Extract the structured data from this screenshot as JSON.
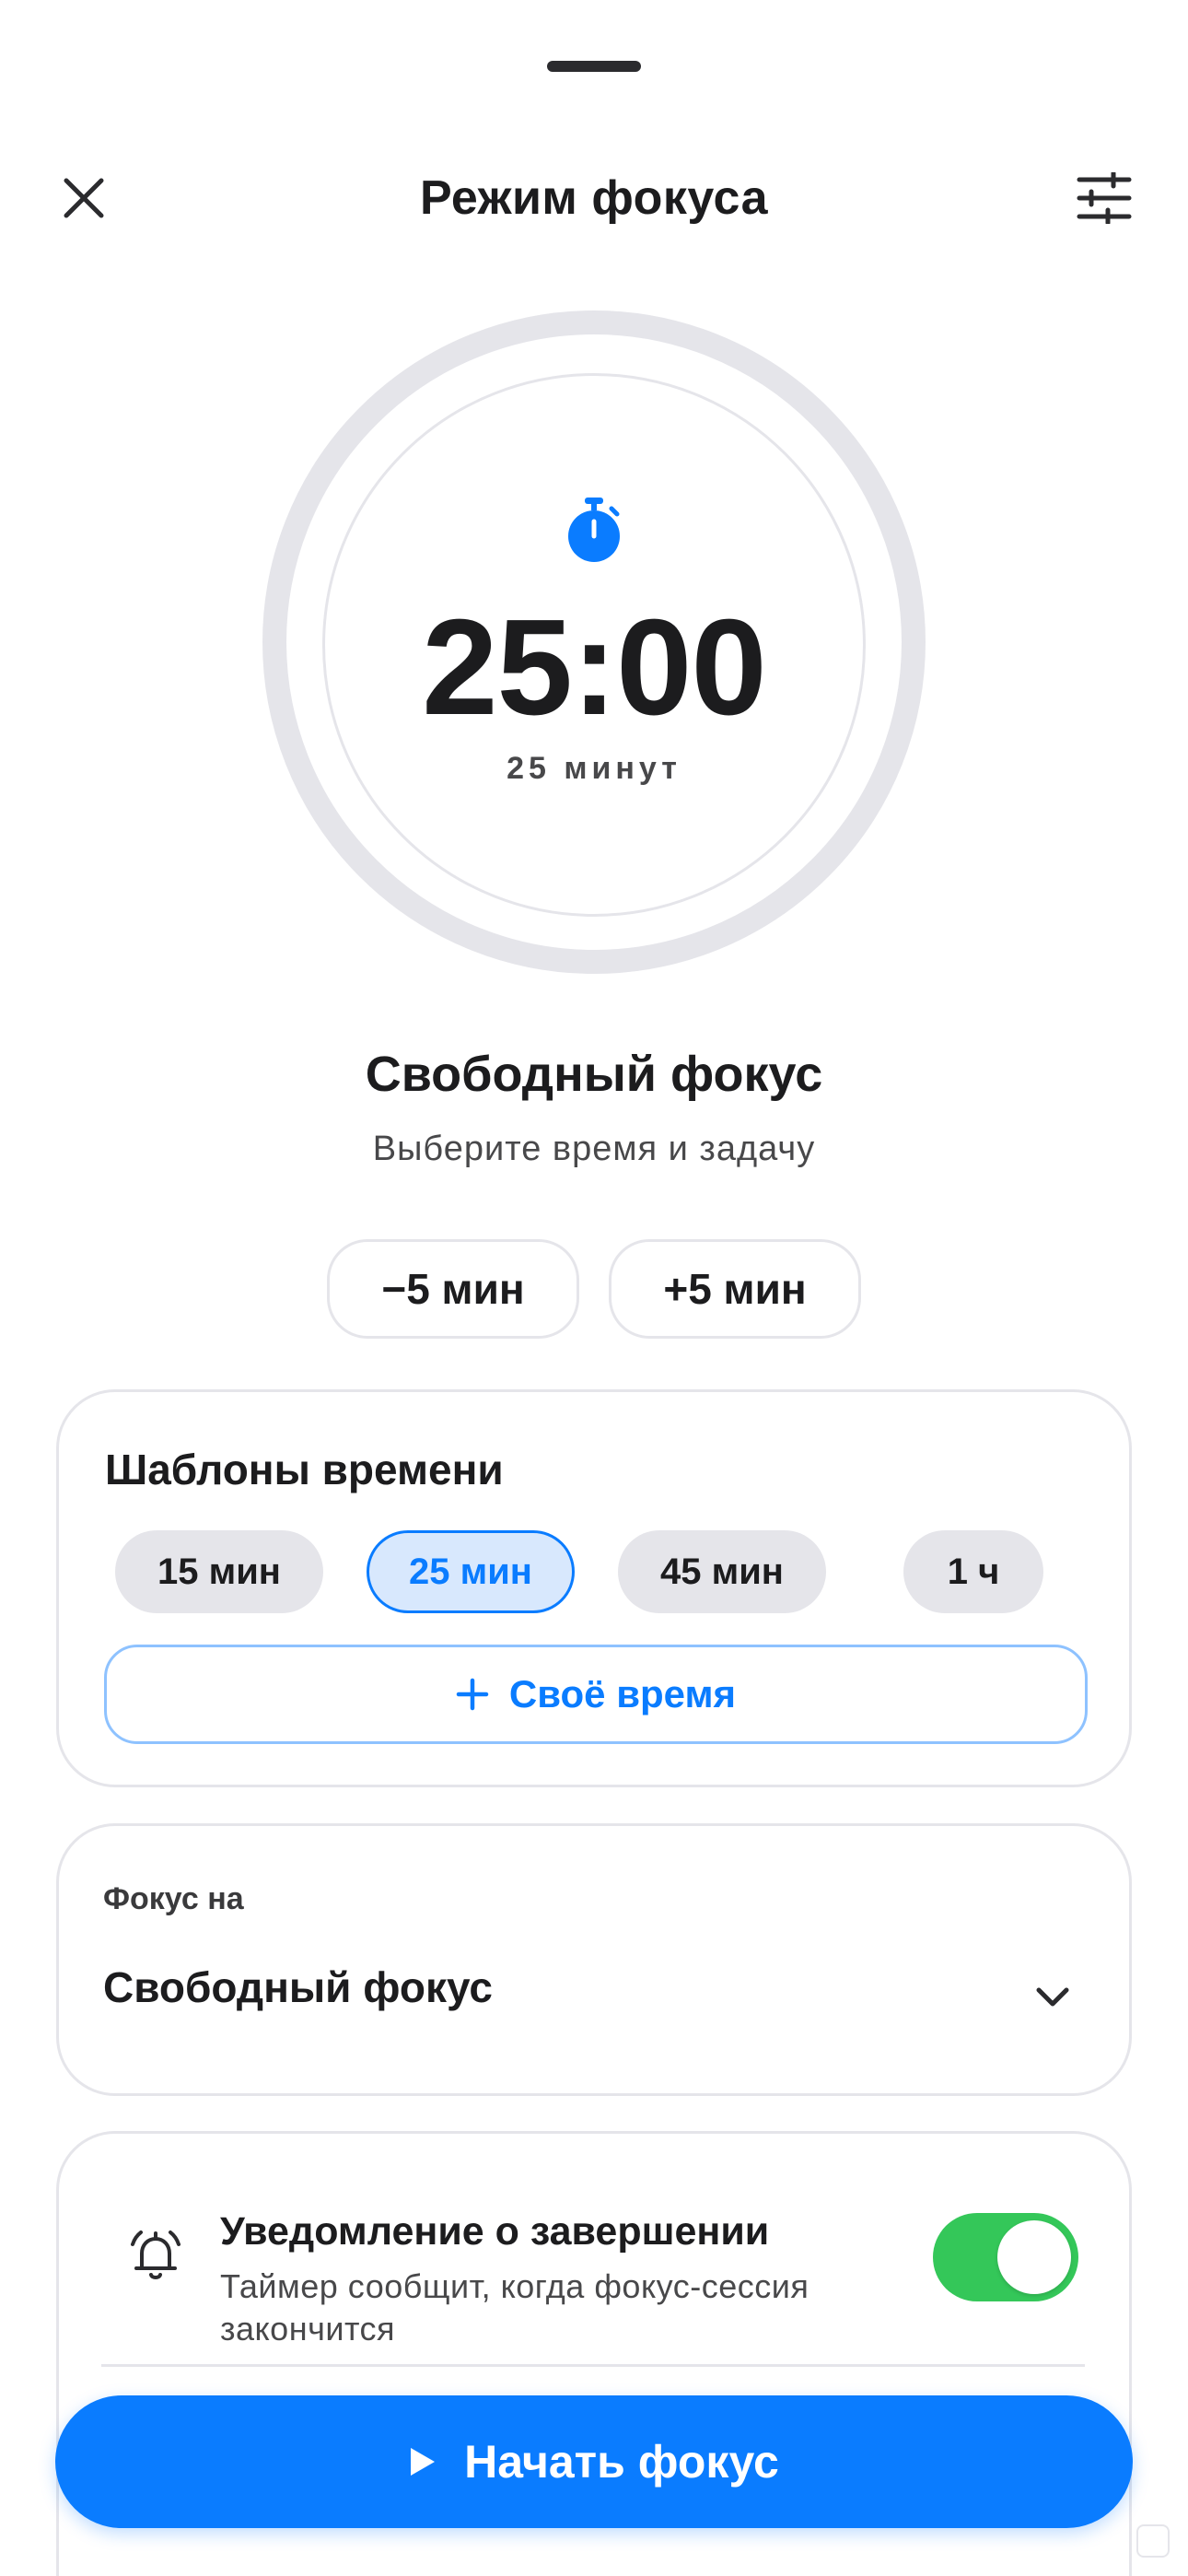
{
  "header": {
    "title": "Режим фокуса",
    "close_icon": "close-icon",
    "settings_icon": "sliders-icon"
  },
  "timer": {
    "time": "25:00",
    "subtitle": "25 минут",
    "icon": "stopwatch-icon",
    "accent_color": "#0a7cff",
    "ring_color": "#e5e5ea"
  },
  "mode": {
    "title": "Свободный фокус",
    "subtitle": "Выберите время и задачу"
  },
  "adjust": {
    "minus_label": "−5 мин",
    "plus_label": "+5 мин"
  },
  "templates": {
    "title": "Шаблоны времени",
    "chips": [
      {
        "label": "15 мин",
        "selected": false
      },
      {
        "label": "25 мин",
        "selected": true
      },
      {
        "label": "45 мин",
        "selected": false
      },
      {
        "label": "1 ч",
        "selected": false
      }
    ],
    "custom_label": "Своё время",
    "custom_icon": "plus-icon"
  },
  "focus": {
    "label": "Фокус на",
    "value": "Свободный фокус",
    "icon": "chevron-down-icon"
  },
  "notification": {
    "title": "Уведомление о завершении",
    "description": "Таймер сообщит, когда фокус-сессия закончится",
    "enabled": true,
    "icon": "bell-icon",
    "toggle_color": "#34c759"
  },
  "start": {
    "label": "Начать фокус",
    "icon": "play-icon",
    "color": "#0a7cff"
  }
}
